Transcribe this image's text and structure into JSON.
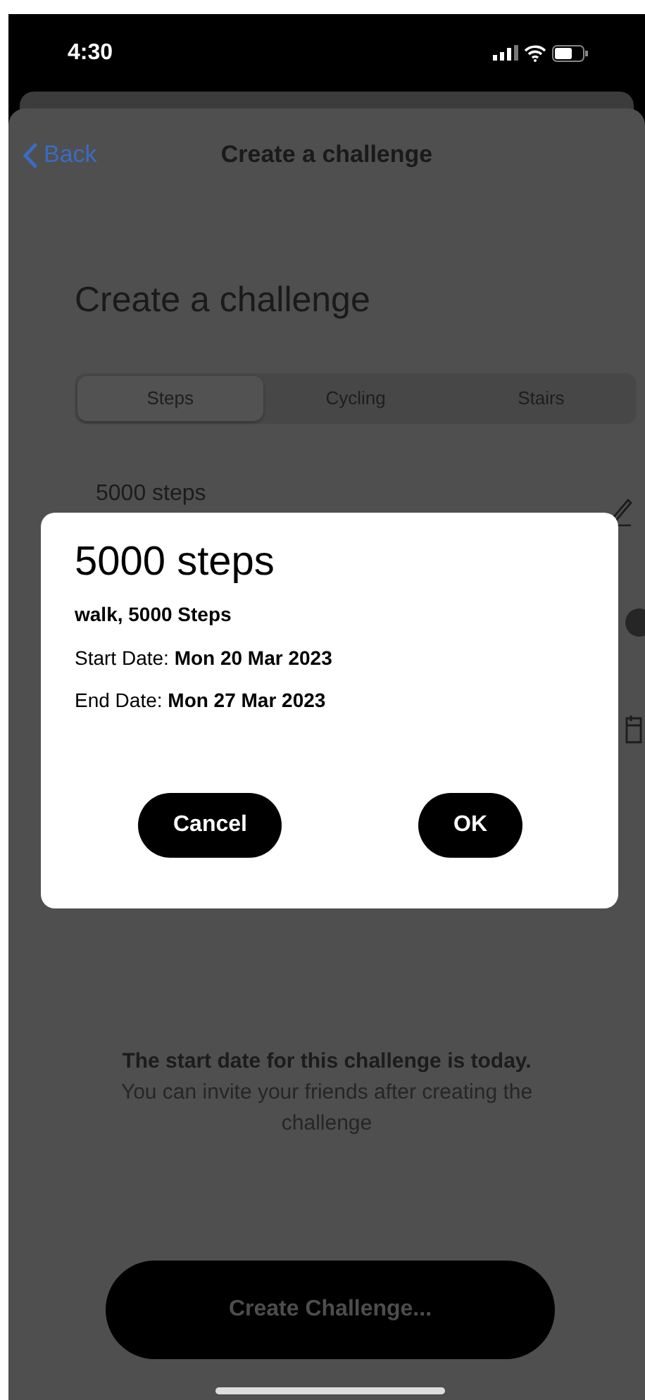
{
  "status_bar": {
    "time": "4:30"
  },
  "nav": {
    "back": "Back",
    "title": "Create a challenge"
  },
  "heading": "Create a challenge",
  "segments": [
    {
      "label": "Steps",
      "selected": true
    },
    {
      "label": "Cycling",
      "selected": false
    },
    {
      "label": "Stairs",
      "selected": false
    }
  ],
  "goal_field": {
    "value": "5000 steps"
  },
  "info": {
    "title": "The start date for this challenge is today.",
    "text": "You can invite your friends after creating the challenge"
  },
  "create_button": "Create Challenge...",
  "dialog": {
    "title": "5000 steps",
    "summary": "walk, 5000 Steps",
    "lines": [
      "Start Date: **Mon 20 Mar 2023**",
      "End Date: **Mon 27 Mar 2023**"
    ],
    "buttons": [
      "Cancel",
      "OK"
    ]
  }
}
